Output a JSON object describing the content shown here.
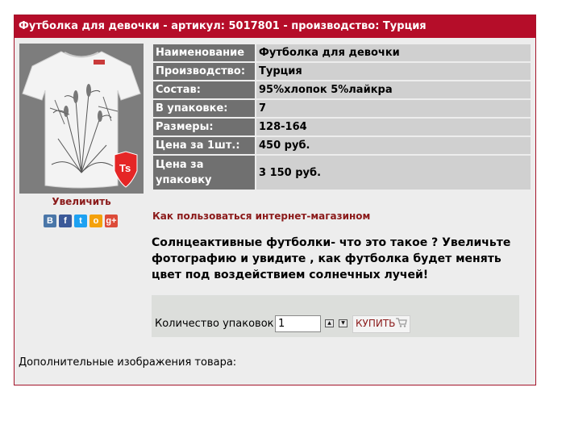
{
  "title": "Футболка для девочки - артикул: 5017801 - производство: Турция",
  "enlarge_label": "Увеличить",
  "share_icons": [
    {
      "name": "vk-icon",
      "glyph": "В",
      "color": "#4a76a8"
    },
    {
      "name": "facebook-icon",
      "glyph": "f",
      "color": "#3b5998"
    },
    {
      "name": "twitter-icon",
      "glyph": "t",
      "color": "#1da1f2"
    },
    {
      "name": "odnoklassniki-icon",
      "glyph": "о",
      "color": "#f4a10b"
    },
    {
      "name": "google-plus-icon",
      "glyph": "g+",
      "color": "#dd4b39"
    }
  ],
  "properties": [
    {
      "label": "Наименование",
      "value": "Футболка для девочки"
    },
    {
      "label": "Производство:",
      "value": "Турция"
    },
    {
      "label": "Состав:",
      "value": "95%хлопок 5%лайкра"
    },
    {
      "label": "В упаковке:",
      "value": "7"
    },
    {
      "label": "Размеры:",
      "value": "128-164"
    },
    {
      "label": "Цена за 1шт.:",
      "value": "450 руб."
    },
    {
      "label": "Цена за упаковку",
      "value": "3 150 руб."
    }
  ],
  "howto_link": "Как пользоваться интернет-магазином",
  "description": "Солнцеактивные футболки- что это такое ? Увеличьте фотографию и увидите ,  как футболка будет менять цвет под воздействием солнечных лучей!",
  "buy": {
    "quantity_label": "Количество упаковок:",
    "quantity_value": "1",
    "buy_label": "КУПИТЬ"
  },
  "extra_images_label": "Дополнительные изображения товара:",
  "logo_text": "Ts",
  "colors": {
    "accent": "#b50d29",
    "link": "#8b1a1a",
    "label_bg": "#707070",
    "value_bg": "#d0d0d0"
  }
}
